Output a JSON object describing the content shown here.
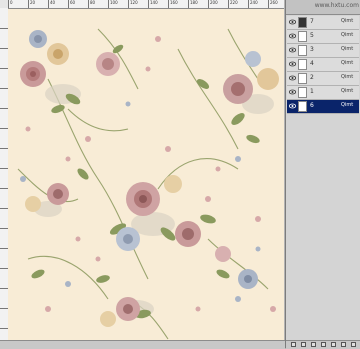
{
  "watermark": "www.hxtu.com",
  "ruler_ticks": [
    "0",
    "20",
    "40",
    "60",
    "80",
    "100",
    "120",
    "140",
    "160",
    "180",
    "200",
    "220",
    "240",
    "260"
  ],
  "layers": [
    {
      "number": "7",
      "name": "Qimt"
    },
    {
      "number": "5",
      "name": "Qimt"
    },
    {
      "number": "3",
      "name": "Qimt"
    },
    {
      "number": "4",
      "name": "Qimt"
    },
    {
      "number": "2",
      "name": "Qimt"
    },
    {
      "number": "1",
      "name": "Qimt"
    },
    {
      "number": "6",
      "name": "Qimt"
    }
  ],
  "colors": {
    "canvas_background": "#f8ecd6",
    "selected_layer": "#0a246a",
    "rose_pink": "#c99a9a",
    "rose_blue": "#a9b4c6",
    "leaf_green": "#8a9a5e"
  }
}
